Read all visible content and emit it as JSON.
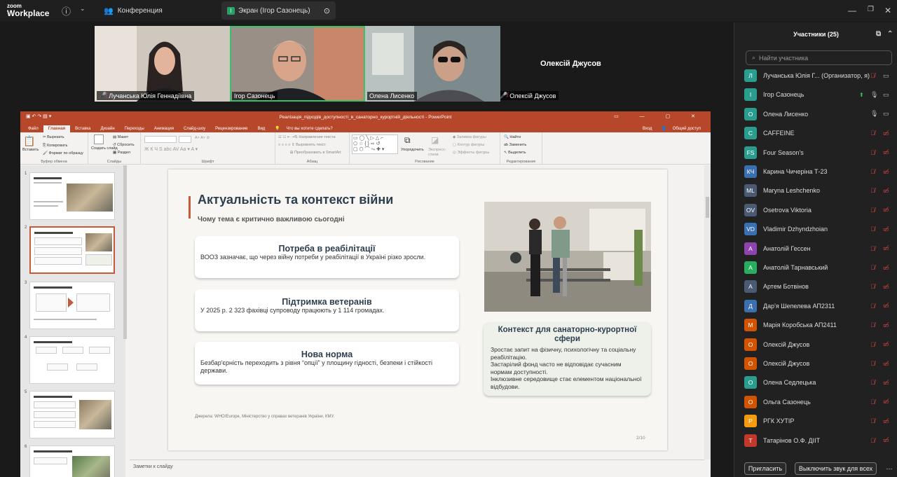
{
  "app": {
    "logo_line1": "zoom",
    "logo_line2": "Workplace"
  },
  "topbar": {
    "meeting_tab": "Конференция",
    "share_tab": "Экран (Ігор Сазонець)",
    "share_badge": "I"
  },
  "videos": [
    {
      "name": "Лучанська Юлія Геннадіївна",
      "muted": true
    },
    {
      "name": "Ігор Сазонець",
      "muted": false
    },
    {
      "name": "Олена Лисенко",
      "muted": false
    },
    {
      "name": "Олексій Джусов",
      "muted": true
    }
  ],
  "video_big_name": "Олексій Джусов",
  "ppt": {
    "title": "Реалізація_підходів_доступності_в_санаторно_курортній_діяльності - PowerPoint",
    "tabs": [
      "Файл",
      "Главная",
      "Вставка",
      "Дизайн",
      "Переходы",
      "Анимация",
      "Слайд-шоу",
      "Рецензирование",
      "Вид",
      "Что вы хотите сделать?"
    ],
    "tabs_right": [
      "Вход",
      "Общий доступ"
    ],
    "ribbon": {
      "paste": "Вставить",
      "cut": "Вырезать",
      "copy": "Копировать",
      "format": "Формат по образцу",
      "g_clipboard": "Буфер обмена",
      "new_slide": "Создать слайд",
      "layout": "Макет",
      "reset": "Сбросить",
      "section": "Раздел",
      "g_slides": "Слайды",
      "g_font": "Шрифт",
      "text_dir": "Направление текста",
      "align_text": "Выровнять текст",
      "smartart": "Преобразовать в SmartArt",
      "g_paragraph": "Абзац",
      "arrange": "Упорядочить",
      "quick_styles": "Экспресс-стили",
      "fill": "Заливка фигуры",
      "outline": "Контур фигуры",
      "effects": "Эффекты фигуры",
      "g_drawing": "Рисование",
      "find": "Найти",
      "replace": "Заменить",
      "select": "Выделить",
      "g_editing": "Редактирование"
    },
    "slide_numbers": [
      "1",
      "2",
      "3",
      "4",
      "5",
      "6"
    ],
    "notes_placeholder": "Заметки к слайду",
    "slide": {
      "title": "Актуальність та контекст війни",
      "subtitle": "Чому тема є критично важливою сьогодні",
      "cards": [
        {
          "title": "Потреба в реабілітації",
          "text": "ВООЗ зазначає, що через війну потреби у реабілітації в Україні різко зросли."
        },
        {
          "title": "Підтримка ветеранів",
          "text": "У 2025 р. 2 323 фахівці супроводу працюють у 1 114 громадах."
        },
        {
          "title": "Нова норма",
          "text": "Безбар'єрність переходить з рівня “опції” у площину гідності, безпеки і стійкості держави."
        }
      ],
      "context_title": "Контекст для санаторно-курортної сфери",
      "context_lines": [
        "Зростає запит на фізичну, психологічну та соціальну реабілітацію.",
        "Застарілий фонд часто не відповідає сучасним нормам доступності.",
        "Інклюзивне середовище стає елементом національної відбудови."
      ],
      "source": "Джерела: WHO/Europe, Міністерство у справах ветеранів України, КМУ.",
      "page": "2/10"
    }
  },
  "participants": {
    "header": "Участники (25)",
    "search_placeholder": "Найти участника",
    "list": [
      {
        "initials": "Л",
        "name": "Лучанська Юлія Г...  (Организатор, я)",
        "color": "#2a9d8f",
        "mic": "off",
        "cam": "on"
      },
      {
        "initials": "I",
        "name": "Ігор Сазонець",
        "color": "#2a9d8f",
        "mic": "on",
        "cam": "on",
        "sharing": true
      },
      {
        "initials": "О",
        "name": "Олена Лисенко",
        "color": "#2a9d8f",
        "mic": "on",
        "cam": "on"
      },
      {
        "initials": "C",
        "name": "CAFFEINE",
        "color": "#2a9d8f",
        "mic": "off",
        "cam": "off"
      },
      {
        "initials": "FS",
        "name": "Four Season's",
        "color": "#2a9d8f",
        "mic": "off",
        "cam": "off"
      },
      {
        "initials": "КЧ",
        "name": "Карина Чичеріна Т-23",
        "color": "#3a6fb0",
        "mic": "off",
        "cam": "off"
      },
      {
        "initials": "ML",
        "name": "Maryna Leshchenko",
        "color": "#4a5a72",
        "mic": "off",
        "cam": "off"
      },
      {
        "initials": "OV",
        "name": "Osetrova Viktoria",
        "color": "#4a5a72",
        "mic": "off",
        "cam": "off"
      },
      {
        "initials": "VD",
        "name": "Vladimir Dzhyndzhoian",
        "color": "#3a6fb0",
        "mic": "off",
        "cam": "off"
      },
      {
        "initials": "А",
        "name": "Анатолій Гессен",
        "color": "#8e44ad",
        "mic": "off",
        "cam": "off"
      },
      {
        "initials": "А",
        "name": "Анатолій Тарнавський",
        "color": "#27ae60",
        "mic": "off",
        "cam": "off"
      },
      {
        "initials": "А",
        "name": "Артем Ботвінов",
        "color": "#4a5a72",
        "mic": "off",
        "cam": "off"
      },
      {
        "initials": "Д",
        "name": "Дар'я Шепелева АП2311",
        "color": "#3a6fb0",
        "mic": "off",
        "cam": "off"
      },
      {
        "initials": "М",
        "name": "Марія Коробська АП2411",
        "color": "#d35400",
        "mic": "off",
        "cam": "off"
      },
      {
        "initials": "О",
        "name": "Олексій Джусов",
        "color": "#d35400",
        "mic": "off",
        "cam": "off"
      },
      {
        "initials": "О",
        "name": "Олексій Джусов",
        "color": "#d35400",
        "mic": "off",
        "cam": "off"
      },
      {
        "initials": "О",
        "name": "Олена Седлецька",
        "color": "#2a9d8f",
        "mic": "off",
        "cam": "off"
      },
      {
        "initials": "О",
        "name": "Ольга Сазонець",
        "color": "#d35400",
        "mic": "off",
        "cam": "off"
      },
      {
        "initials": "Р",
        "name": "РГК ХУТІР",
        "color": "#f39c12",
        "mic": "off",
        "cam": "off"
      },
      {
        "initials": "Т",
        "name": "Татарінов О.Ф. ДІІТ",
        "color": "#c0392b",
        "mic": "off",
        "cam": "off"
      }
    ],
    "invite": "Пригласить",
    "mute_all": "Выключить звук для всех"
  }
}
